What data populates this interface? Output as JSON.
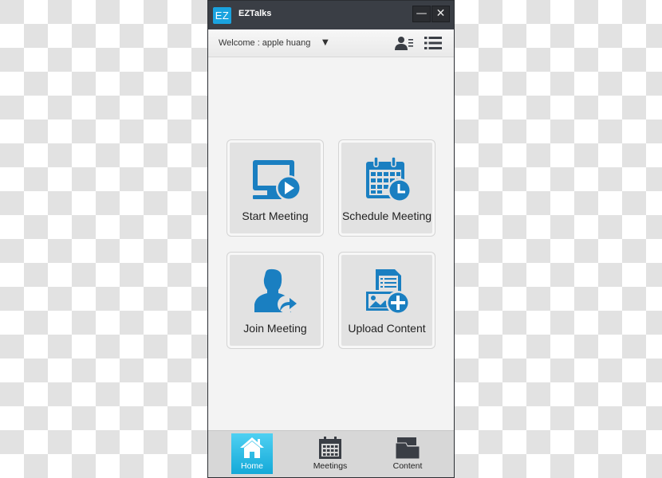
{
  "window": {
    "logo_text": "EZ",
    "app_title": "EZTalks",
    "minimize_symbol": "—",
    "close_symbol": "✕"
  },
  "header": {
    "welcome_text": "Welcome : apple huang",
    "dropdown_symbol": "▼",
    "icons": [
      "contacts-list-icon",
      "menu-list-icon"
    ]
  },
  "tiles": [
    {
      "label": "Start Meeting",
      "icon": "monitor-play-icon"
    },
    {
      "label": "Schedule Meeting",
      "icon": "calendar-clock-icon"
    },
    {
      "label": "Join Meeting",
      "icon": "person-arrow-icon"
    },
    {
      "label": "Upload Content",
      "icon": "document-image-plus-icon"
    }
  ],
  "bottom_nav": [
    {
      "label": "Home",
      "icon": "home-icon",
      "active": true
    },
    {
      "label": "Meetings",
      "icon": "calendar-icon",
      "active": false
    },
    {
      "label": "Content",
      "icon": "folder-icon",
      "active": false
    }
  ],
  "colors": {
    "accent_blue": "#1a7fc1",
    "logo_blue": "#1aa3df",
    "active_tab": "#14a9d8",
    "titlebar": "#3a3e45"
  }
}
